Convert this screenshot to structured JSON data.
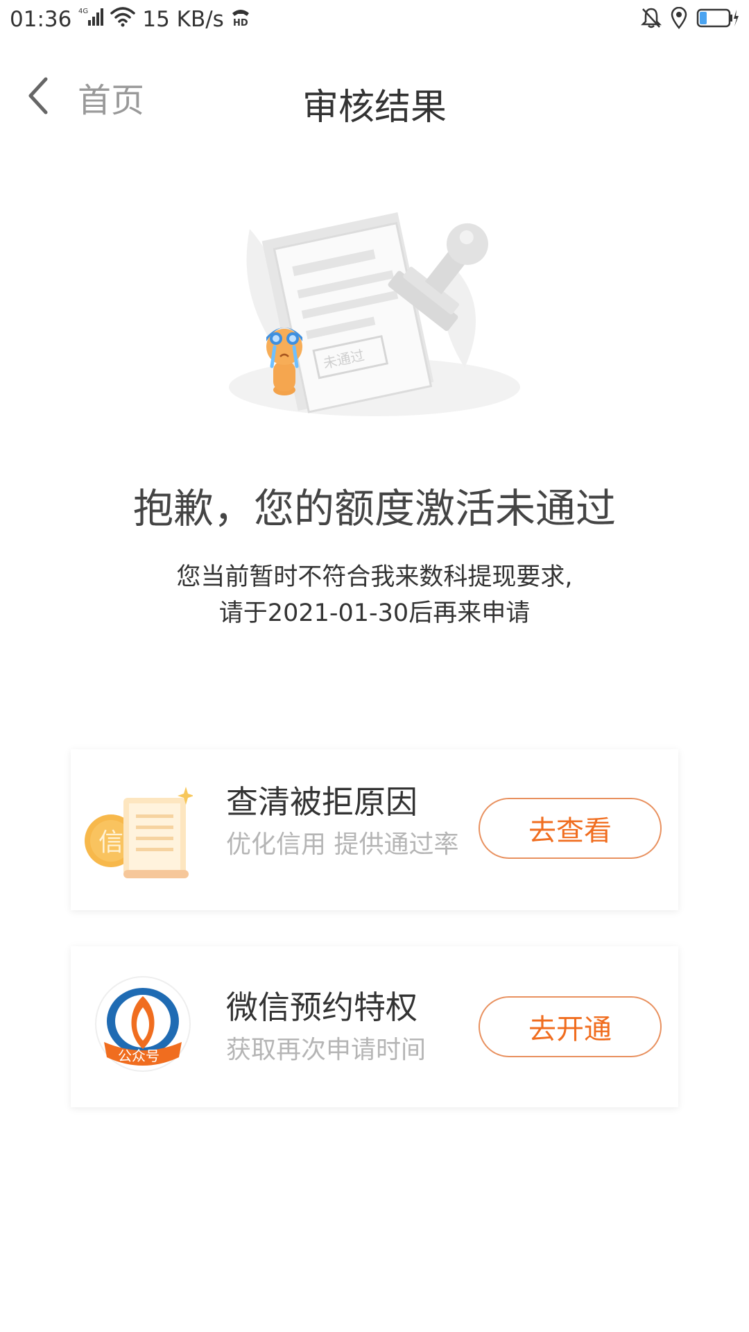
{
  "status_bar": {
    "time": "01:36",
    "network": "4G",
    "speed": "15 KB/s",
    "hd": "HD"
  },
  "nav": {
    "back_label": "首页",
    "title": "审核结果"
  },
  "illustration": {
    "stamp_text": "未通过"
  },
  "result": {
    "title": "抱歉，您的额度激活未通过",
    "desc_line1": "您当前暂时不符合我来数科提现要求,",
    "desc_line2": "请于2021-01-30后再来申请"
  },
  "cards": [
    {
      "title": "查清被拒原因",
      "subtitle": "优化信用 提供通过率",
      "button": "去查看",
      "icon_char": "信"
    },
    {
      "title": "微信预约特权",
      "subtitle": "获取再次申请时间",
      "button": "去开通",
      "icon_badge": "公众号"
    }
  ],
  "colors": {
    "accent": "#f06d1f",
    "button_border": "#e8905e",
    "subtitle_gray": "#b5b5b5",
    "logo_blue": "#1f6bb3"
  }
}
